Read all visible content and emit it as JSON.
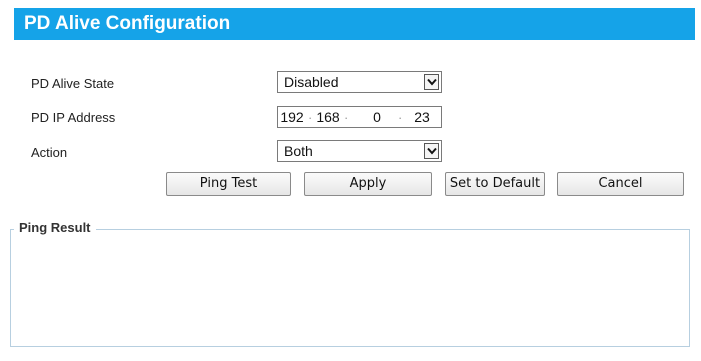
{
  "header": {
    "title": "PD Alive Configuration"
  },
  "form": {
    "state": {
      "label": "PD Alive State",
      "value": "Disabled"
    },
    "ip": {
      "label": "PD IP Address",
      "octets": [
        "192",
        "168",
        "0",
        "23"
      ]
    },
    "action": {
      "label": "Action",
      "value": "Both"
    }
  },
  "buttons": {
    "ping": "Ping Test",
    "apply": "Apply",
    "default": "Set to Default",
    "cancel": "Cancel"
  },
  "result": {
    "legend": "Ping Result",
    "text": ""
  },
  "icons": {
    "dropdown": "chevron-down-icon"
  },
  "colors": {
    "header_bg": "#15a3e8",
    "header_text": "#ffffff",
    "fieldset_border": "#b7cfe0"
  }
}
